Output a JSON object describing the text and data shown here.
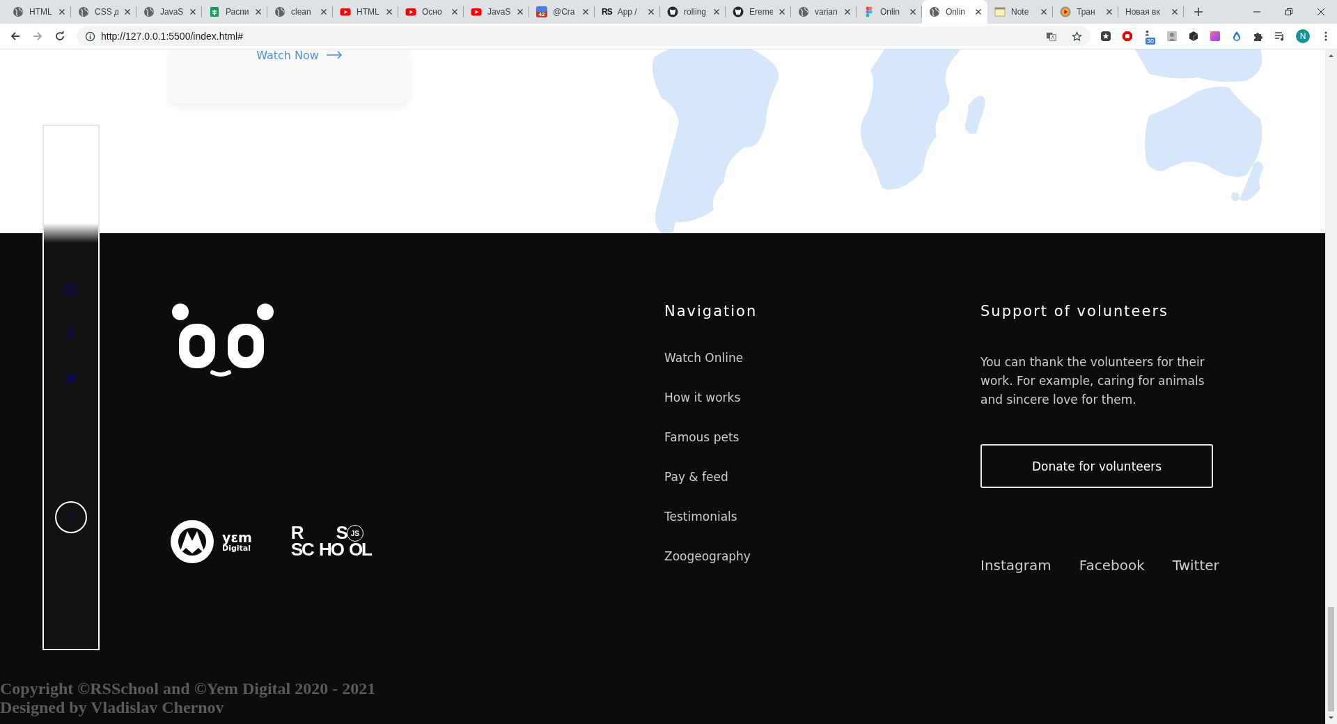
{
  "browser": {
    "tabs": [
      {
        "title": "HTML",
        "kind": "globe",
        "selected": false
      },
      {
        "title": "CSS д",
        "kind": "globe",
        "selected": false
      },
      {
        "title": "JavaS",
        "kind": "globe",
        "selected": false
      },
      {
        "title": "Распи",
        "kind": "sheets",
        "selected": false
      },
      {
        "title": "clean",
        "kind": "globe",
        "selected": false
      },
      {
        "title": "HTML",
        "kind": "youtube",
        "selected": false
      },
      {
        "title": "Осно",
        "kind": "youtube",
        "selected": false
      },
      {
        "title": "JavaS",
        "kind": "youtube",
        "selected": false
      },
      {
        "title": "@Cra",
        "kind": "calendar",
        "badge": "42",
        "selected": false
      },
      {
        "title": "App /",
        "kind": "text-logo",
        "badge": "RS",
        "selected": false
      },
      {
        "title": "rolling",
        "kind": "github",
        "selected": false
      },
      {
        "title": "Ereme",
        "kind": "github",
        "selected": false
      },
      {
        "title": "varian",
        "kind": "globe",
        "selected": false
      },
      {
        "title": "Onlin",
        "kind": "figma",
        "selected": false
      },
      {
        "title": "Onlin",
        "kind": "globe",
        "selected": true
      },
      {
        "title": "Note",
        "kind": "notepad",
        "selected": false
      },
      {
        "title": "Тран",
        "kind": "player",
        "selected": false
      },
      {
        "title": "Новая вк",
        "kind": "blank",
        "selected": false
      }
    ],
    "address": "http://127.0.0.1:5500/index.html#",
    "extension_badge": "30",
    "profile_initial": "N"
  },
  "page": {
    "card_link": "Watch Now",
    "footer": {
      "logos": {
        "yem": [
          "yεm",
          "Digital"
        ],
        "rs": [
          "R",
          "S",
          "SC",
          "HO",
          "OL"
        ],
        "rs_badge": "JS"
      },
      "navigation": {
        "title": "Navigation",
        "items": [
          "Watch Online",
          "How it works",
          "Famous pets",
          "Pay & feed",
          "Testimonials",
          "Zoogeography"
        ]
      },
      "support": {
        "title": "Support of volunteers",
        "text": "You can thank the volunteers for their work. For example, caring for animals and sincere love for them.",
        "button": "Donate for volunteers"
      },
      "social": [
        "Instagram",
        "Facebook",
        "Twitter"
      ],
      "copyright": [
        "Copyright ©RSSchool and ©Yem Digital 2020 - 2021",
        "Designed by Vladislav Chernov"
      ]
    }
  }
}
